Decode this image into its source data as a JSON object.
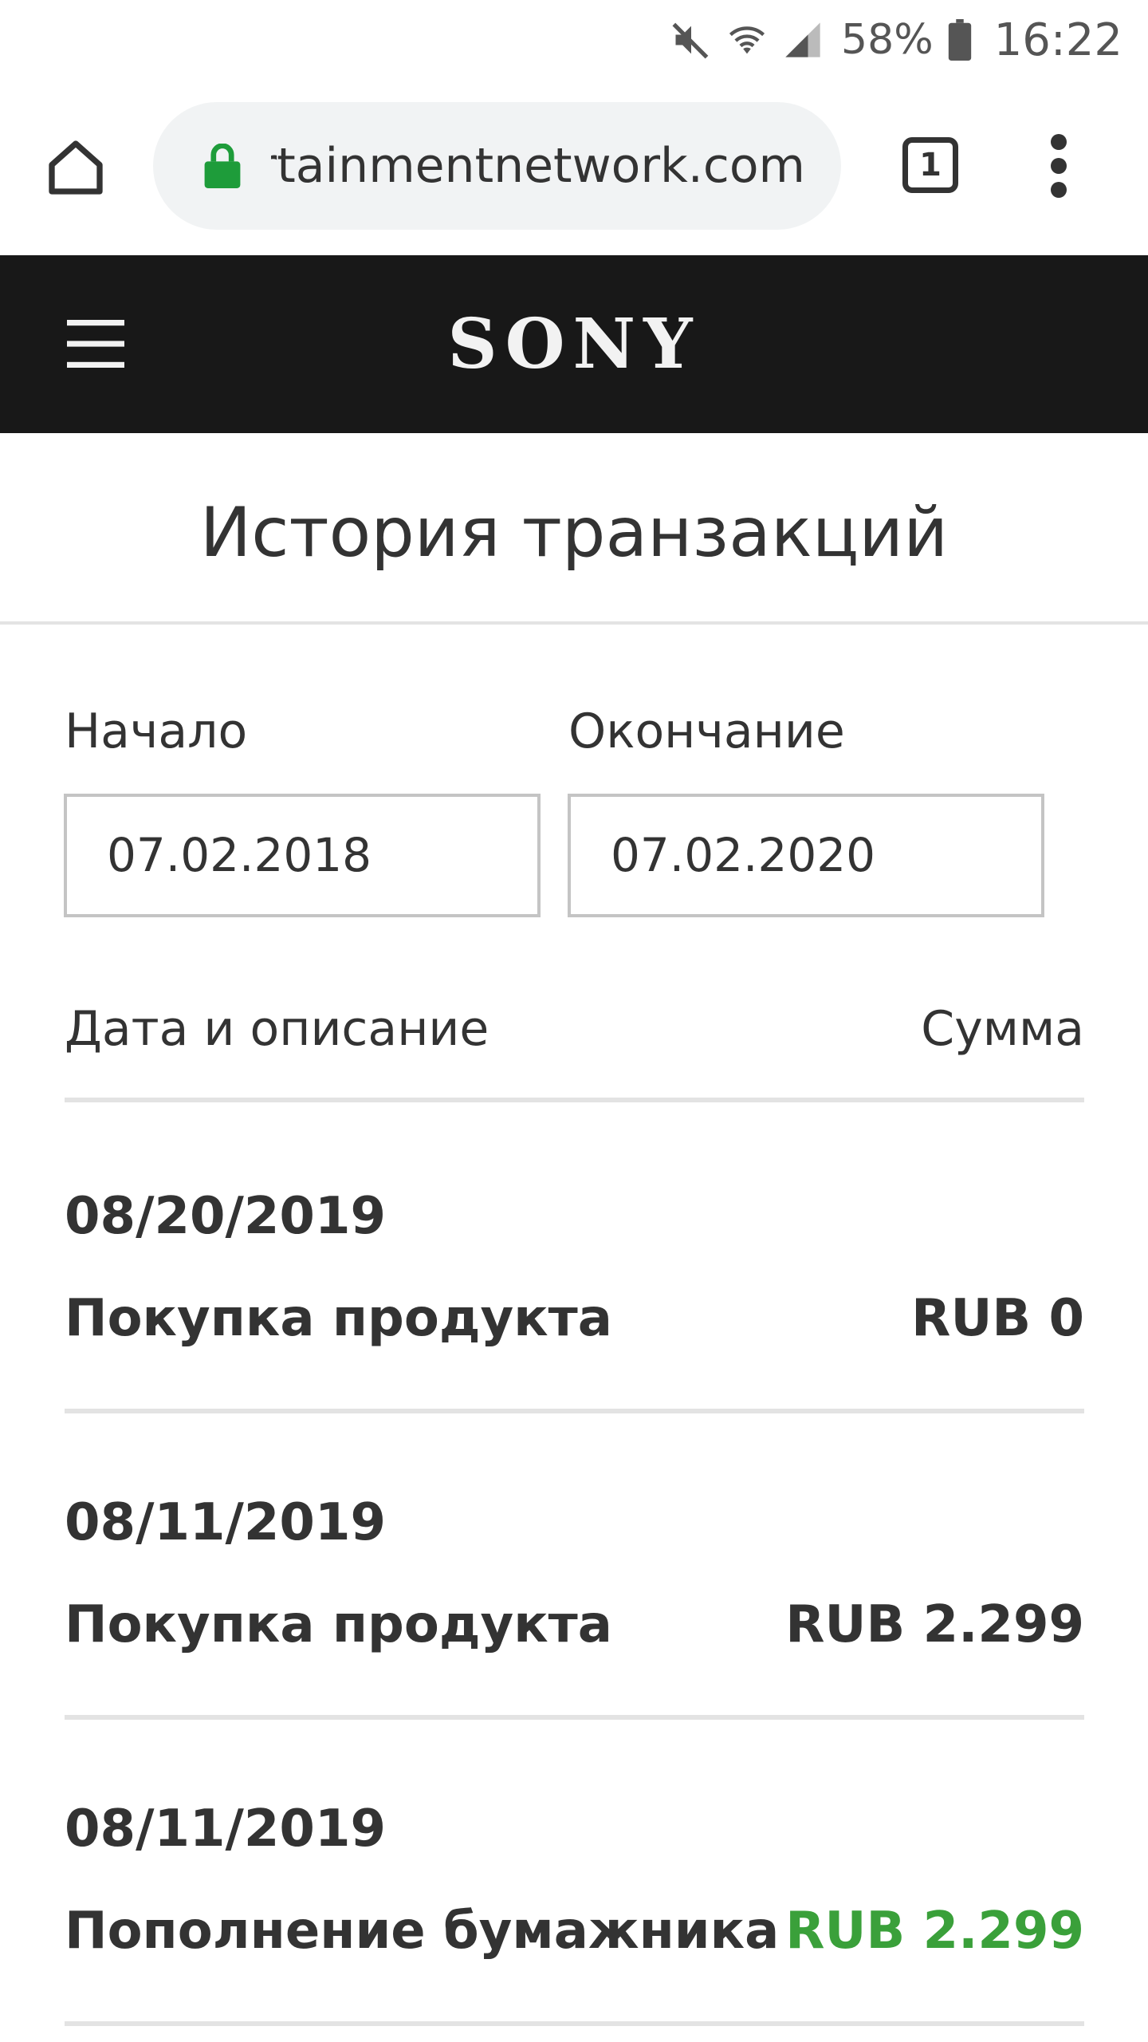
{
  "status_bar": {
    "battery_percent": "58%",
    "time": "16:22",
    "icons": [
      "mute-icon",
      "wifi-icon",
      "signal-icon",
      "battery-icon"
    ]
  },
  "browser": {
    "url": "entertainmentnetwork.com",
    "tab_count": "1",
    "icons": [
      "home-icon",
      "lock-icon",
      "tabs-icon",
      "more-vert-icon"
    ],
    "lock_color": "#1e9c3a"
  },
  "header": {
    "logo": "SONY",
    "background": "#181818",
    "icons": [
      "hamburger-menu-icon"
    ]
  },
  "page": {
    "title": "История транзакций"
  },
  "date_range": {
    "start_label": "Начало",
    "start_value": "07.02.2018",
    "end_label": "Окончание",
    "end_value": "07.02.2020"
  },
  "table": {
    "col_left": "Дата и описание",
    "col_right": "Сумма",
    "rows": [
      {
        "date": "08/20/2019",
        "description": "Покупка продукта",
        "amount": "RUB 0"
      },
      {
        "date": "08/11/2019",
        "description": "Покупка продукта",
        "amount": "RUB 2.299"
      },
      {
        "date": "08/11/2019",
        "description": "Пополнение бумажника",
        "amount": "RUB 2.299",
        "amount_color": "#3aa03a"
      }
    ]
  }
}
